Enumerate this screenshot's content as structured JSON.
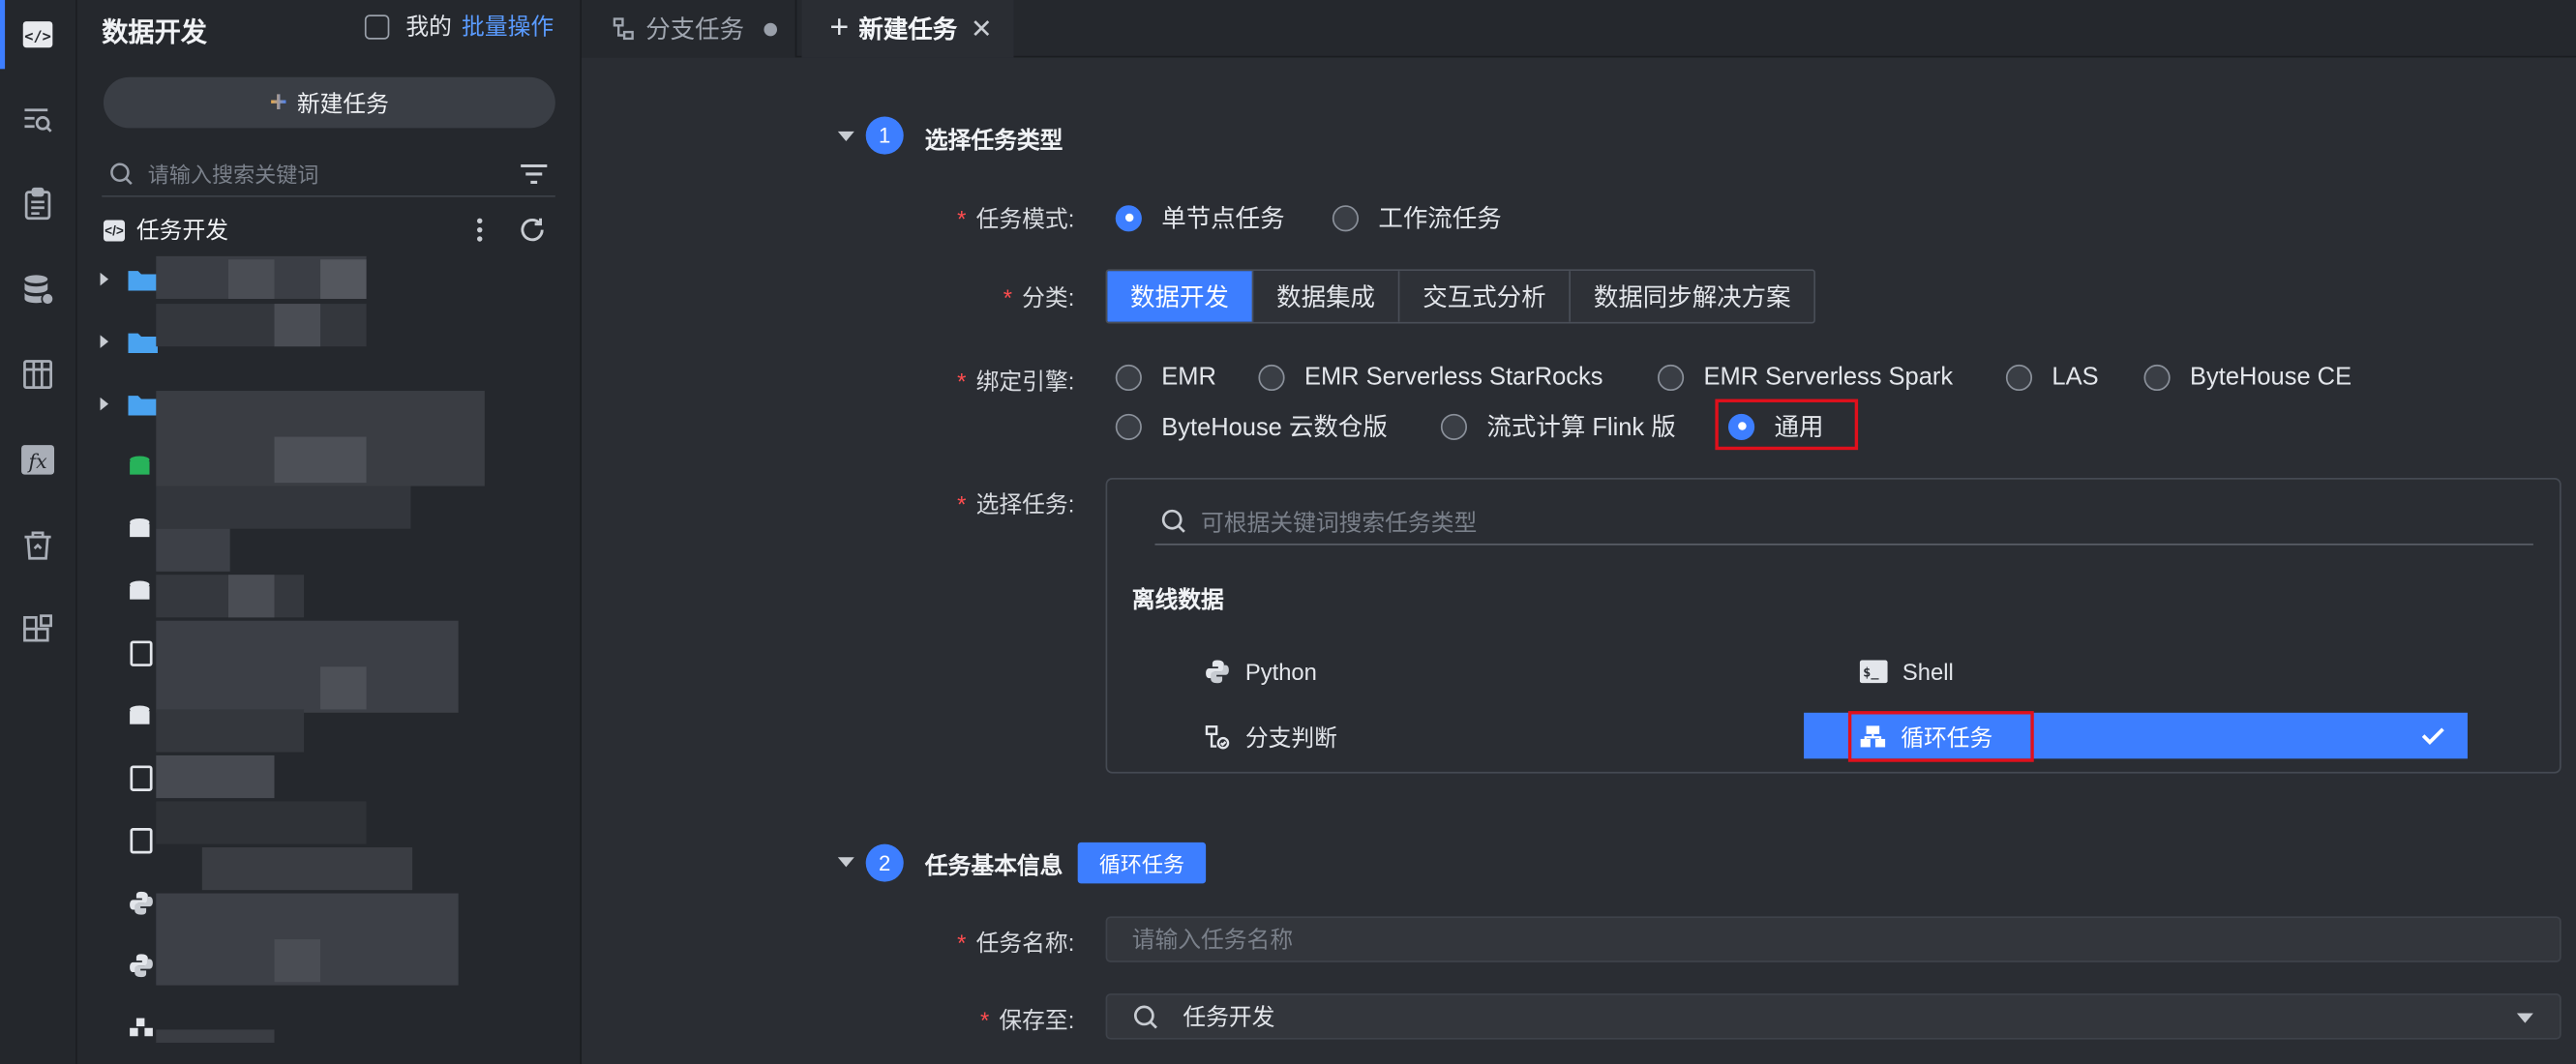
{
  "sidebar": {
    "title": "数据开发",
    "mine_label": "我的",
    "batch_label": "批量操作",
    "new_task_label": "新建任务",
    "search_placeholder": "请输入搜索关键词",
    "tree_root": "任务开发"
  },
  "tabs": [
    {
      "label": "分支任务"
    },
    {
      "label": "新建任务"
    }
  ],
  "section1": {
    "step": "1",
    "title": "选择任务类型",
    "mode_label": "任务模式:",
    "modes": [
      "单节点任务",
      "工作流任务"
    ],
    "category_label": "分类:",
    "categories": [
      "数据开发",
      "数据集成",
      "交互式分析",
      "数据同步解决方案"
    ],
    "engine_label": "绑定引擎:",
    "engines": [
      "EMR",
      "EMR Serverless StarRocks",
      "EMR Serverless Spark",
      "LAS",
      "ByteHouse CE",
      "ByteHouse 云数仓版",
      "流式计算 Flink 版",
      "通用"
    ],
    "select_label": "选择任务:",
    "task_search_placeholder": "可根据关键词搜索任务类型",
    "group_title": "离线数据",
    "task_types": [
      "Python",
      "Shell",
      "分支判断",
      "循环任务"
    ]
  },
  "section2": {
    "step": "2",
    "title": "任务基本信息",
    "tag": "循环任务",
    "name_label": "任务名称:",
    "name_placeholder": "请输入任务名称",
    "save_label": "保存至:",
    "save_value": "任务开发"
  }
}
